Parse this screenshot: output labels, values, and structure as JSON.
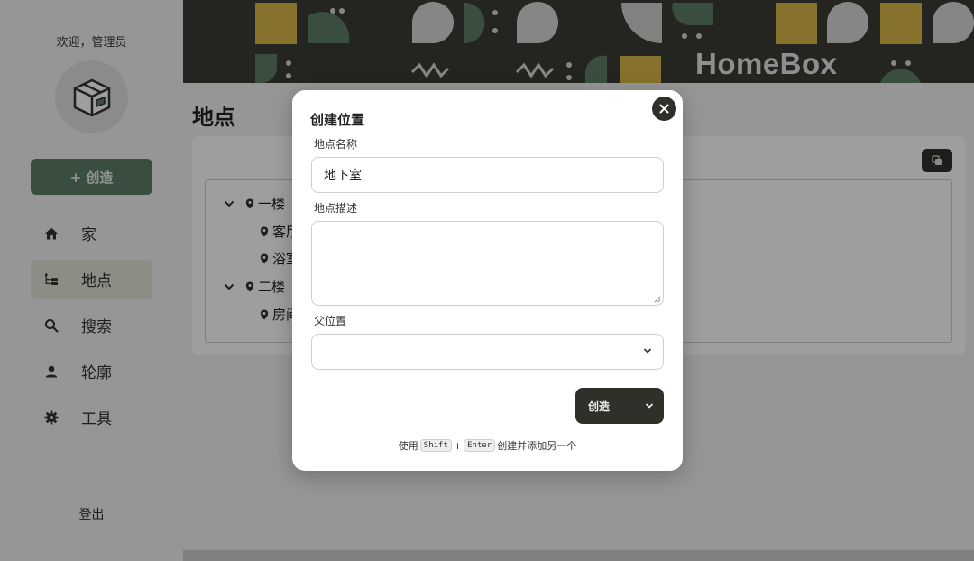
{
  "sidebar": {
    "welcome": "欢迎，管理员",
    "create_label": "+ 创造",
    "items": [
      {
        "label": "家",
        "icon": "home-icon"
      },
      {
        "label": "地点",
        "icon": "tree-icon"
      },
      {
        "label": "搜索",
        "icon": "search-icon"
      },
      {
        "label": "轮廓",
        "icon": "user-icon"
      },
      {
        "label": "工具",
        "icon": "gear-icon"
      }
    ],
    "logout": "登出"
  },
  "header": {
    "logo": "HomeBox"
  },
  "main": {
    "title": "地点",
    "tree": [
      {
        "label": "一楼",
        "expanded": true
      },
      {
        "label": "客厅"
      },
      {
        "label": "浴室"
      },
      {
        "label": "二楼",
        "expanded": true
      },
      {
        "label": "房间"
      }
    ]
  },
  "modal": {
    "title": "创建位置",
    "name_label": "地点名称",
    "name_value": "地下室",
    "desc_label": "地点描述",
    "desc_value": "",
    "parent_label": "父位置",
    "parent_value": "",
    "submit_label": "创造",
    "hint_prefix": "使用",
    "hint_key1": "Shift",
    "hint_plus": "+",
    "hint_key2": "Enter",
    "hint_suffix": "创建并添加另一个"
  },
  "colors": {
    "primary": "#5c7f67",
    "dark": "#2f3029",
    "banner": "#3a3b34",
    "active_nav": "#dfe6d5",
    "pattern_yellow": "#d9b64a",
    "pattern_green": "#5c7f67",
    "pattern_grey": "#d8d8d8"
  }
}
